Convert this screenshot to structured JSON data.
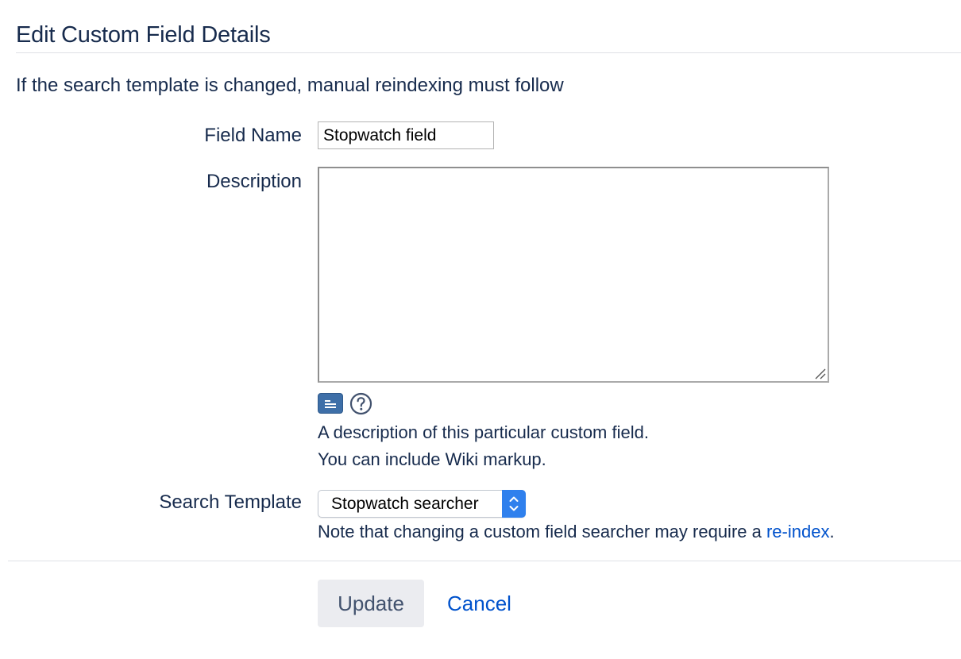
{
  "header": {
    "title": "Edit Custom Field Details",
    "intro": "If the search template is changed, manual reindexing must follow"
  },
  "form": {
    "field_name": {
      "label": "Field Name",
      "value": "Stopwatch field"
    },
    "description": {
      "label": "Description",
      "value": "",
      "help_line_1": "A description of this particular custom field.",
      "help_line_2": "You can include Wiki markup.",
      "wiki_icon": "wiki-markup-icon",
      "help_icon": "question-circle-icon"
    },
    "search_template": {
      "label": "Search Template",
      "selected": "Stopwatch searcher",
      "note_prefix": "Note that changing a custom field searcher may require a ",
      "note_link": "re-index",
      "note_suffix": "."
    }
  },
  "actions": {
    "update_label": "Update",
    "cancel_label": "Cancel"
  },
  "colors": {
    "text": "#172b4d",
    "link": "#0052cc",
    "select_accent": "#2f80ed",
    "wiki_icon_bg": "#3e6fa8",
    "button_bg": "#ebecf0"
  }
}
